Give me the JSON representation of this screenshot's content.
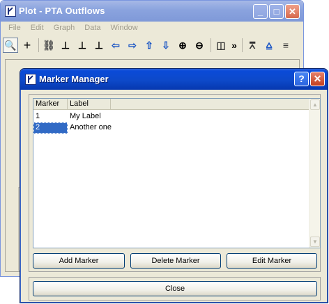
{
  "plot_window": {
    "title": "Plot - PTA Outflows",
    "menu": [
      "File",
      "Edit",
      "Graph",
      "Data",
      "Window"
    ],
    "toolbar_icons": [
      "zoom-select-icon",
      "crosshair-icon",
      "link-icon",
      "axis-icon",
      "axis-r-icon",
      "axis-s-icon",
      "pan-left-icon",
      "pan-right-icon",
      "pan-up-icon",
      "pan-down-icon",
      "zoom-in-icon",
      "zoom-out-icon",
      "split-icon",
      "more-icon",
      "shift-up-icon",
      "shift-down-icon",
      "stack-icon"
    ],
    "toolbar_glyphs": [
      "🔍",
      "+",
      "⛓",
      "⊥",
      "⊥",
      "⊥",
      "⇦",
      "⇨",
      "⇧",
      "⇩",
      "⊕",
      "⊖",
      "◫",
      "»",
      "⩞",
      "⩠",
      "≡"
    ]
  },
  "marker_manager": {
    "title": "Marker Manager",
    "table": {
      "headers": [
        "Marker",
        "Label"
      ],
      "rows": [
        {
          "marker": "1",
          "label": "My Label"
        },
        {
          "marker": "2",
          "label": "Another one"
        }
      ],
      "selected_row": 1
    },
    "buttons": {
      "add": "Add Marker",
      "delete": "Delete Marker",
      "edit": "Edit Marker",
      "close": "Close"
    },
    "caption_help": "?",
    "caption_close": "✕"
  },
  "caption": {
    "minimize": "_",
    "maximize": "□",
    "close": "✕"
  },
  "colors": {
    "dialog_titlebar": "#0a4ad8",
    "selection": "#316ac5",
    "inactive_titlebar": "#8aa3de"
  }
}
